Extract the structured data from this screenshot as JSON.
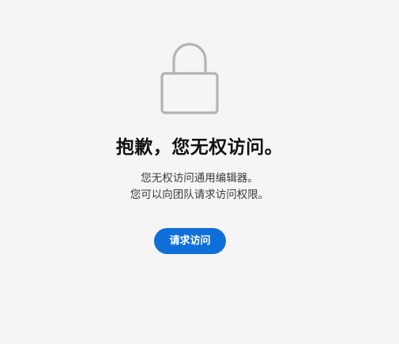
{
  "icon": {
    "name": "lock-icon",
    "color": "#b3b3b3"
  },
  "heading": {
    "title": "抱歉，您无权访问。"
  },
  "message": {
    "line1": "您无权访问通用编辑器。",
    "line2": "您可以向团队请求访问权限。"
  },
  "actions": {
    "request_label": "请求访问"
  },
  "colors": {
    "background": "#f5f5f5",
    "button": "#0f6fd8",
    "button_text": "#ffffff",
    "title_text": "#111111",
    "body_text": "#3a3a3a"
  }
}
